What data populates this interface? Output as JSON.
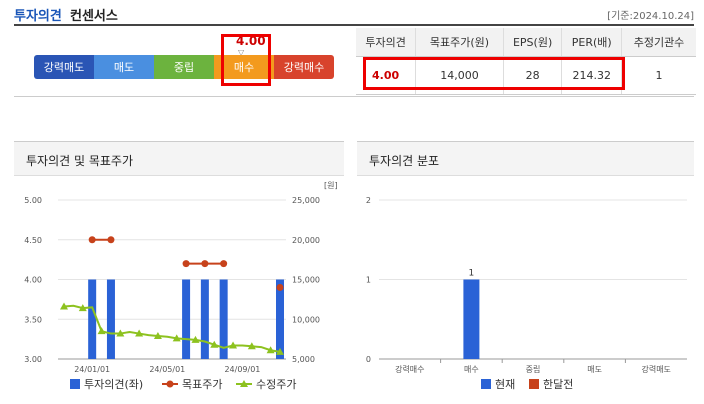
{
  "header": {
    "title": "투자의견",
    "subtitle": "컨센서스",
    "date": "[기준:2024.10.24]"
  },
  "scale": {
    "labels": [
      "강력매도",
      "매도",
      "중립",
      "매수",
      "강력매수"
    ],
    "current_value": "4.00",
    "current_label": "매수"
  },
  "table": {
    "headers": [
      "투자의견",
      "목표주가(원)",
      "EPS(원)",
      "PER(배)",
      "추정기관수"
    ],
    "row": [
      "4.00",
      "14,000",
      "28",
      "214.32",
      "1"
    ]
  },
  "panels": {
    "left_title": "투자의견 및 목표주가",
    "right_title": "투자의견 분포"
  },
  "colors": {
    "opinion_bar": "#2a62d6",
    "target_line": "#c7421b",
    "price_line": "#8dc21f",
    "prev_month": "#c7421b"
  },
  "chart_data": [
    {
      "type": "bar+line",
      "x_ticks": [
        "24/01/01",
        "24/05/01",
        "24/09/01"
      ],
      "left_axis": {
        "ylim": [
          3.0,
          5.0
        ],
        "ticks": [
          "5.00",
          "4.50",
          "4.00",
          "3.50",
          "3.00"
        ]
      },
      "right_axis": {
        "unit": "[원]",
        "ylim": [
          5000,
          25000
        ],
        "ticks": [
          "25,000",
          "20,000",
          "15,000",
          "10,000",
          "5,000"
        ]
      },
      "series": [
        {
          "name": "투자의견(좌)",
          "kind": "bar",
          "points": [
            [
              3,
              4.0
            ],
            [
              5,
              4.0
            ],
            [
              13,
              4.0
            ],
            [
              15,
              4.0
            ],
            [
              17,
              4.0
            ],
            [
              23,
              4.0
            ]
          ]
        },
        {
          "name": "목표주가",
          "kind": "line",
          "segments": [
            [
              [
                3,
                20000
              ],
              [
                5,
                20000
              ]
            ],
            [
              [
                13,
                17000
              ],
              [
                15,
                17000
              ],
              [
                17,
                17000
              ]
            ]
          ],
          "points": [
            [
              23,
              14000
            ]
          ]
        },
        {
          "name": "수정주가",
          "kind": "line",
          "points": [
            [
              0,
              11600
            ],
            [
              1,
              11700
            ],
            [
              2,
              11400
            ],
            [
              3,
              11500
            ],
            [
              4,
              8500
            ],
            [
              5,
              8200
            ],
            [
              6,
              8200
            ],
            [
              7,
              8400
            ],
            [
              8,
              8200
            ],
            [
              9,
              8000
            ],
            [
              10,
              7900
            ],
            [
              11,
              7800
            ],
            [
              12,
              7600
            ],
            [
              13,
              7500
            ],
            [
              14,
              7400
            ],
            [
              15,
              7200
            ],
            [
              16,
              6800
            ],
            [
              17,
              6400
            ],
            [
              18,
              6700
            ],
            [
              19,
              6700
            ],
            [
              20,
              6600
            ],
            [
              21,
              6500
            ],
            [
              22,
              6100
            ],
            [
              23,
              5900
            ]
          ]
        }
      ],
      "legend": [
        "투자의견(좌)",
        "목표주가",
        "수정주가"
      ]
    },
    {
      "type": "bar",
      "categories": [
        "강력매수",
        "매수",
        "중립",
        "매도",
        "강력매도"
      ],
      "ylim": [
        0,
        2
      ],
      "y_ticks": [
        "2",
        "1",
        "0"
      ],
      "series": [
        {
          "name": "현재",
          "values": [
            0,
            1,
            0,
            0,
            0
          ]
        },
        {
          "name": "한달전",
          "values": [
            0,
            0,
            0,
            0,
            0
          ]
        }
      ],
      "data_labels": [
        "1"
      ],
      "legend": [
        "현재",
        "한달전"
      ]
    }
  ]
}
